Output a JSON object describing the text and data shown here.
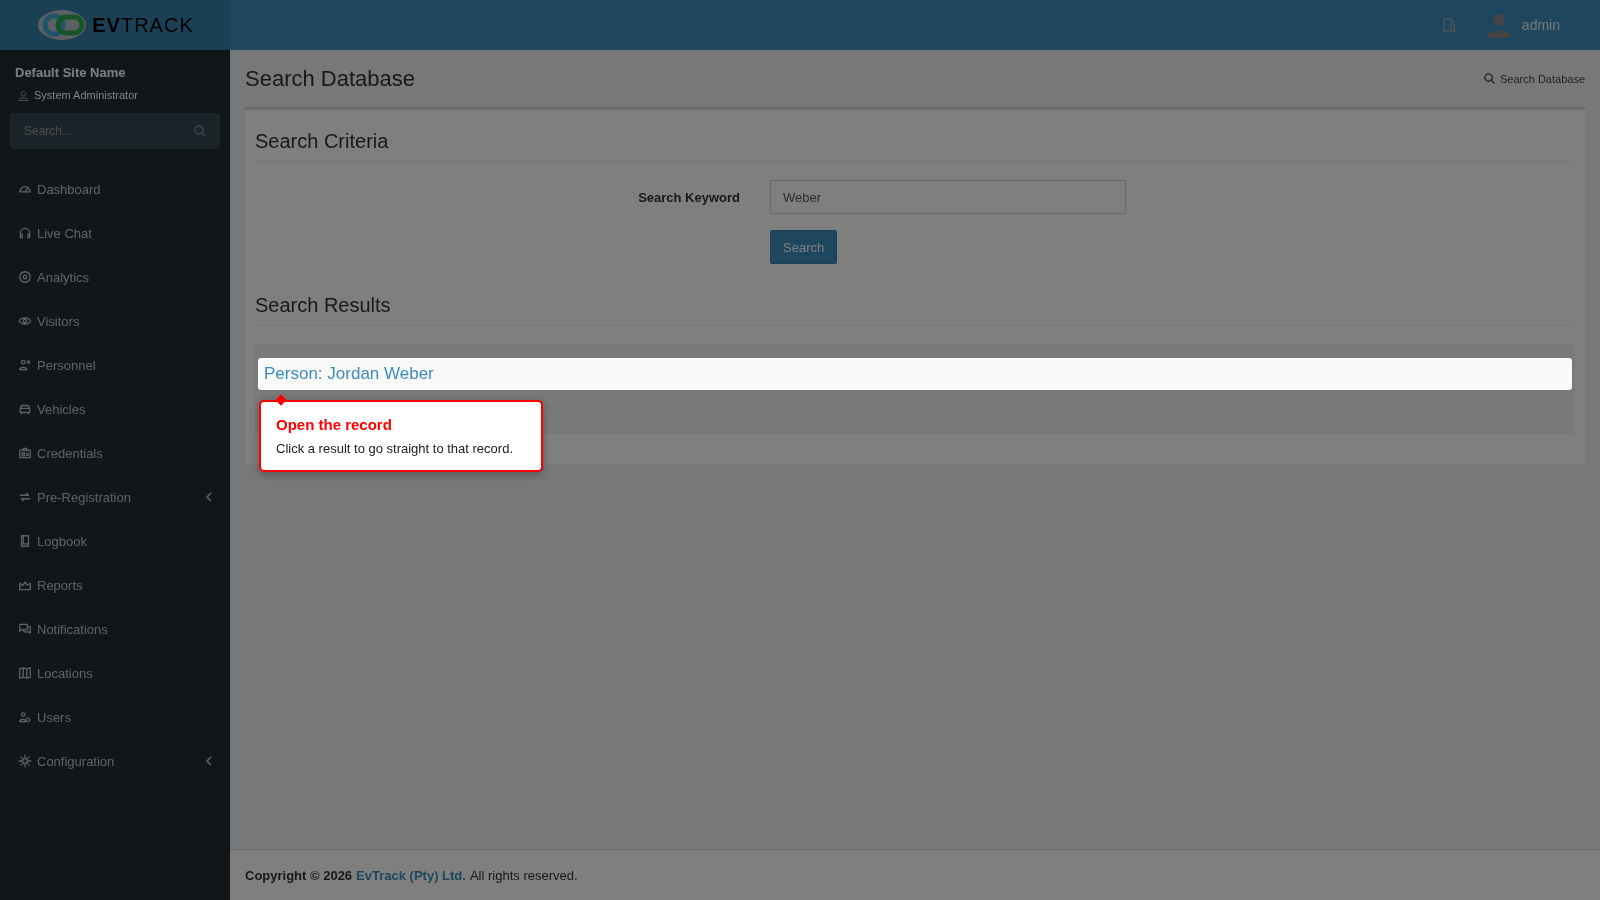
{
  "header": {
    "logo": {
      "bold": "EV",
      "rest": "TRACK"
    },
    "user": "admin"
  },
  "sidebar": {
    "site_name": "Default Site Name",
    "role": "System Administrator",
    "search": {
      "placeholder": "Search..."
    },
    "items": [
      {
        "label": "Dashboard",
        "has_submenu": false
      },
      {
        "label": "Live Chat",
        "has_submenu": false
      },
      {
        "label": "Analytics",
        "has_submenu": false
      },
      {
        "label": "Visitors",
        "has_submenu": false
      },
      {
        "label": "Personnel",
        "has_submenu": false
      },
      {
        "label": "Vehicles",
        "has_submenu": false
      },
      {
        "label": "Credentials",
        "has_submenu": false
      },
      {
        "label": "Pre-Registration",
        "has_submenu": true
      },
      {
        "label": "Logbook",
        "has_submenu": false
      },
      {
        "label": "Reports",
        "has_submenu": false
      },
      {
        "label": "Notifications",
        "has_submenu": false
      },
      {
        "label": "Locations",
        "has_submenu": false
      },
      {
        "label": "Users",
        "has_submenu": false
      },
      {
        "label": "Configuration",
        "has_submenu": true
      }
    ]
  },
  "page": {
    "title": "Search Database",
    "breadcrumb": "Search Database"
  },
  "criteria": {
    "heading": "Search Criteria",
    "label": "Search Keyword",
    "value": "Weber",
    "button": "Search"
  },
  "results": {
    "heading": "Search Results",
    "items": [
      {
        "label": "Person: Jordan Weber"
      }
    ]
  },
  "tooltip": {
    "title": "Open the record",
    "text": "Click a result to go straight to that record."
  },
  "footer": {
    "prefix": "Copyright © 2026",
    "link": "EvTrack (Pty) Ltd.",
    "suffix": "All rights reserved."
  }
}
